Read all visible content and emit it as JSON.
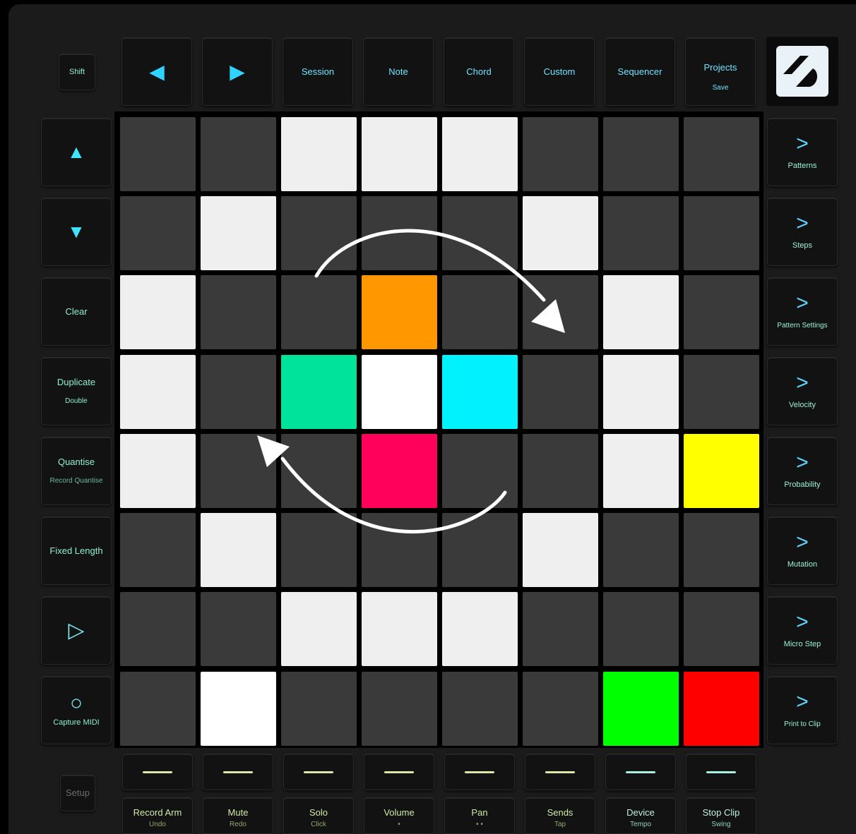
{
  "top_buttons": {
    "shift": "Shift",
    "left_arrow": "◀",
    "right_arrow": "▶",
    "session": "Session",
    "note": "Note",
    "chord": "Chord",
    "custom": "Custom",
    "sequencer": "Sequencer",
    "projects": "Projects",
    "projects_sub": "Save"
  },
  "left_buttons": {
    "up": "▲",
    "down": "▼",
    "clear": "Clear",
    "duplicate": "Duplicate",
    "duplicate_sub": "Double",
    "quantise": "Quantise",
    "quantise_sub": "Record Quantise",
    "fixed_length": "Fixed Length",
    "play": "▷",
    "record": "○",
    "record_sub": "Capture MIDI"
  },
  "right_buttons": [
    {
      "chevron": ">",
      "label": "Patterns"
    },
    {
      "chevron": ">",
      "label": "Steps"
    },
    {
      "chevron": ">",
      "label": "Pattern Settings"
    },
    {
      "chevron": ">",
      "label": "Velocity"
    },
    {
      "chevron": ">",
      "label": "Probability"
    },
    {
      "chevron": ">",
      "label": "Mutation"
    },
    {
      "chevron": ">",
      "label": "Micro Step"
    },
    {
      "chevron": ">",
      "label": "Print to Clip"
    }
  ],
  "bottom_labels": [
    {
      "label": "Record Arm",
      "sub": "Undo"
    },
    {
      "label": "Mute",
      "sub": "Redo"
    },
    {
      "label": "Solo",
      "sub": "Click"
    },
    {
      "label": "Volume",
      "sub": "•"
    },
    {
      "label": "Pan",
      "sub": "• •"
    },
    {
      "label": "Sends",
      "sub": "Tap"
    },
    {
      "label": "Device",
      "sub": "Tempo"
    },
    {
      "label": "Stop Clip",
      "sub": "Swing"
    }
  ],
  "setup": "Setup",
  "colors": {
    "off": "#3a3a3a",
    "lit": "#efefef",
    "white": "#ffffff",
    "orange": "#ff9800",
    "mint": "#00e39a",
    "cyan": "#00f2ff",
    "magenta": "#ff005a",
    "yellow": "#ffff00",
    "green": "#00ff00",
    "red": "#ff0000"
  },
  "grid": [
    [
      "off",
      "off",
      "lit",
      "lit",
      "lit",
      "off",
      "off",
      "off"
    ],
    [
      "off",
      "lit",
      "off",
      "off",
      "off",
      "lit",
      "off",
      "off"
    ],
    [
      "lit",
      "off",
      "off",
      "orange",
      "off",
      "off",
      "lit",
      "off"
    ],
    [
      "lit",
      "off",
      "mint",
      "white",
      "cyan",
      "off",
      "lit",
      "off"
    ],
    [
      "lit",
      "off",
      "off",
      "magenta",
      "off",
      "off",
      "lit",
      "yellow"
    ],
    [
      "off",
      "lit",
      "off",
      "off",
      "off",
      "lit",
      "off",
      "off"
    ],
    [
      "off",
      "off",
      "lit",
      "lit",
      "lit",
      "off",
      "off",
      "off"
    ],
    [
      "off",
      "white",
      "off",
      "off",
      "off",
      "off",
      "green",
      "red"
    ]
  ]
}
